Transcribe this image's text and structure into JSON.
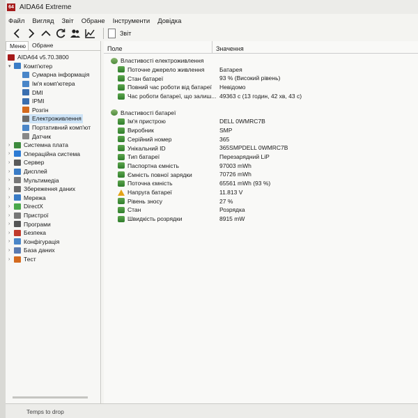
{
  "window": {
    "logo": "64",
    "title": "AIDA64 Extreme"
  },
  "menu": [
    "Файл",
    "Вигляд",
    "Звіт",
    "Обране",
    "Інструменти",
    "Довідка"
  ],
  "toolbar": {
    "icons": [
      "back-arrow-icon",
      "forward-arrow-icon",
      "up-icon",
      "refresh-icon",
      "users-icon",
      "chart-icon"
    ],
    "report_label": "Звіт"
  },
  "left_tabs": [
    "Меню",
    "Обране"
  ],
  "tree": [
    {
      "label": "AIDA64 v5.70.3800",
      "level": 0,
      "arrow": "",
      "icon": "aida64-logo-icon",
      "color": "#a51a1a"
    },
    {
      "label": "Комп'ютер",
      "level": 1,
      "arrow": "v",
      "icon": "computer-icon",
      "color": "#3a7cc6"
    },
    {
      "label": "Сумарна інформація",
      "level": 2,
      "arrow": "",
      "icon": "summary-icon",
      "color": "#4a86c8"
    },
    {
      "label": "Ім'я комп'ютера",
      "level": 2,
      "arrow": "",
      "icon": "computer-name-icon",
      "color": "#4a86c8"
    },
    {
      "label": "DMI",
      "level": 2,
      "arrow": "",
      "icon": "dmi-icon",
      "color": "#3a6fb0"
    },
    {
      "label": "IPMI",
      "level": 2,
      "arrow": "",
      "icon": "ipmi-icon",
      "color": "#3a6fb0"
    },
    {
      "label": "Розгін",
      "level": 2,
      "arrow": "",
      "icon": "overclock-icon",
      "color": "#d46a1e"
    },
    {
      "label": "Електроживлення",
      "level": 2,
      "arrow": "",
      "icon": "power-icon",
      "color": "#6b6b6b",
      "selected": true
    },
    {
      "label": "Портативний комп'ют",
      "level": 2,
      "arrow": "",
      "icon": "portable-icon",
      "color": "#4a86c8"
    },
    {
      "label": "Датчик",
      "level": 2,
      "arrow": "",
      "icon": "sensor-icon",
      "color": "#888888"
    },
    {
      "label": "Системна плата",
      "level": 1,
      "arrow": ">",
      "icon": "motherboard-icon",
      "color": "#3c8a3c"
    },
    {
      "label": "Операційна система",
      "level": 1,
      "arrow": ">",
      "icon": "os-icon",
      "color": "#2d7bd4"
    },
    {
      "label": "Сервер",
      "level": 1,
      "arrow": ">",
      "icon": "server-icon",
      "color": "#5a5a5a"
    },
    {
      "label": "Дисплей",
      "level": 1,
      "arrow": ">",
      "icon": "display-icon",
      "color": "#3a7cc6"
    },
    {
      "label": "Мультимедіа",
      "level": 1,
      "arrow": ">",
      "icon": "multimedia-icon",
      "color": "#777777"
    },
    {
      "label": "Збереження даних",
      "level": 1,
      "arrow": ">",
      "icon": "storage-icon",
      "color": "#6a6a6a"
    },
    {
      "label": "Мережа",
      "level": 1,
      "arrow": ">",
      "icon": "network-icon",
      "color": "#3a7cc6"
    },
    {
      "label": "DirectX",
      "level": 1,
      "arrow": ">",
      "icon": "directx-icon",
      "color": "#4aa84a"
    },
    {
      "label": "Пристрої",
      "level": 1,
      "arrow": ">",
      "icon": "devices-icon",
      "color": "#777777"
    },
    {
      "label": "Програми",
      "level": 1,
      "arrow": ">",
      "icon": "programs-icon",
      "color": "#555555"
    },
    {
      "label": "Безпека",
      "level": 1,
      "arrow": ">",
      "icon": "security-icon",
      "color": "#c03a2b"
    },
    {
      "label": "Конфігурація",
      "level": 1,
      "arrow": ">",
      "icon": "config-icon",
      "color": "#4a86c8"
    },
    {
      "label": "База даних",
      "level": 1,
      "arrow": ">",
      "icon": "database-icon",
      "color": "#5a7ab0"
    },
    {
      "label": "Тест",
      "level": 1,
      "arrow": ">",
      "icon": "test-icon",
      "color": "#d46a1e"
    }
  ],
  "columns": {
    "field": "Поле",
    "value": "Значення"
  },
  "groups": [
    {
      "title": "Властивості електроживлення",
      "rows": [
        {
          "field": "Поточне джерело живлення",
          "value": "Батарея",
          "icon": "battery-icon"
        },
        {
          "field": "Стан батареї",
          "value": "93 % (Високий рівень)",
          "icon": "battery-icon"
        },
        {
          "field": "Повний час роботи від батареї",
          "value": "Невідомо",
          "icon": "battery-icon"
        },
        {
          "field": "Час роботи батареї, що залиш...",
          "value": "49363 с (13 годин, 42 хв, 43 с)",
          "icon": "battery-icon"
        }
      ]
    },
    {
      "title": "Властивості батареї",
      "rows": [
        {
          "field": "Ім'я пристрою",
          "value": "DELL 0WMRC7B",
          "icon": "battery-icon"
        },
        {
          "field": "Виробник",
          "value": "SMP",
          "icon": "battery-icon"
        },
        {
          "field": "Серійний номер",
          "value": "365",
          "icon": "battery-icon"
        },
        {
          "field": "Унікальний ID",
          "value": "365SMPDELL 0WMRC7B",
          "icon": "battery-icon"
        },
        {
          "field": "Тип батареї",
          "value": "Перезарядний LiP",
          "icon": "battery-icon"
        },
        {
          "field": "Паспортна ємність",
          "value": "97003 mWh",
          "icon": "battery-icon"
        },
        {
          "field": "Ємність повної зарядки",
          "value": "70726 mWh",
          "icon": "battery-icon"
        },
        {
          "field": "Поточна ємність",
          "value": "65561 mWh  (93 %)",
          "icon": "battery-icon"
        },
        {
          "field": "Напруга батареї",
          "value": "11.813 V",
          "icon": "warning-icon"
        },
        {
          "field": "Рівень зносу",
          "value": "27 %",
          "icon": "battery-icon"
        },
        {
          "field": "Стан",
          "value": "Розрядка",
          "icon": "battery-icon"
        },
        {
          "field": "Швидкість розрядки",
          "value": "8915 mW",
          "icon": "battery-icon"
        }
      ]
    }
  ],
  "status": "Temps to drop"
}
